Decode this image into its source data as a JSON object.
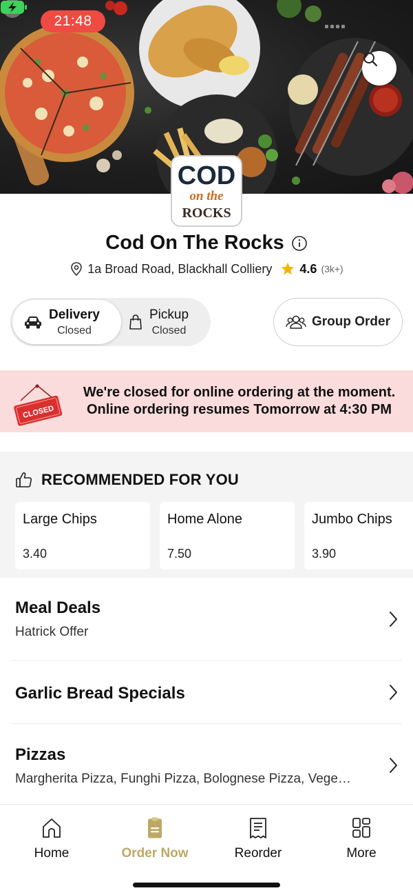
{
  "status_bar": {
    "time": "21:48"
  },
  "restaurant": {
    "logo_text": {
      "line1": "COD",
      "line2": "on the",
      "line3": "ROCKS"
    },
    "name": "Cod On The Rocks",
    "address": "1a Broad Road, Blackhall Colliery",
    "rating": "4.6",
    "rating_count": "(3k+)"
  },
  "order_mode": {
    "delivery": {
      "label": "Delivery",
      "status": "Closed"
    },
    "pickup": {
      "label": "Pickup",
      "status": "Closed"
    },
    "group_order_label": "Group Order"
  },
  "closed_banner": {
    "sign_text": "CLOSED",
    "line1": "We're closed for online ordering at the moment.",
    "line2": "Online ordering resumes Tomorrow at 4:30 PM"
  },
  "recommended": {
    "title": "RECOMMENDED FOR YOU",
    "items": [
      {
        "name": "Large Chips",
        "price": "3.40"
      },
      {
        "name": "Home Alone",
        "price": "7.50"
      },
      {
        "name": "Jumbo Chips",
        "price": "3.90"
      }
    ]
  },
  "categories": [
    {
      "name": "Meal Deals",
      "subtitle": "Hatrick Offer"
    },
    {
      "name": "Garlic Bread Specials",
      "subtitle": ""
    },
    {
      "name": "Pizzas",
      "subtitle": "Margherita Pizza, Funghi Pizza, Bolognese Pizza, Vege…"
    }
  ],
  "bottom_nav": [
    {
      "label": "Home",
      "icon": "home-icon"
    },
    {
      "label": "Order Now",
      "icon": "order-icon",
      "active": true
    },
    {
      "label": "Reorder",
      "icon": "receipt-icon"
    },
    {
      "label": "More",
      "icon": "grid-icon"
    }
  ],
  "colors": {
    "accent_gold": "#bda865",
    "time_pill": "#ef4a43",
    "closed_banner_bg": "#fadcdc",
    "closed_sign_red": "#d9302f",
    "star": "#f2b705",
    "battery_green": "#3fd15c"
  }
}
